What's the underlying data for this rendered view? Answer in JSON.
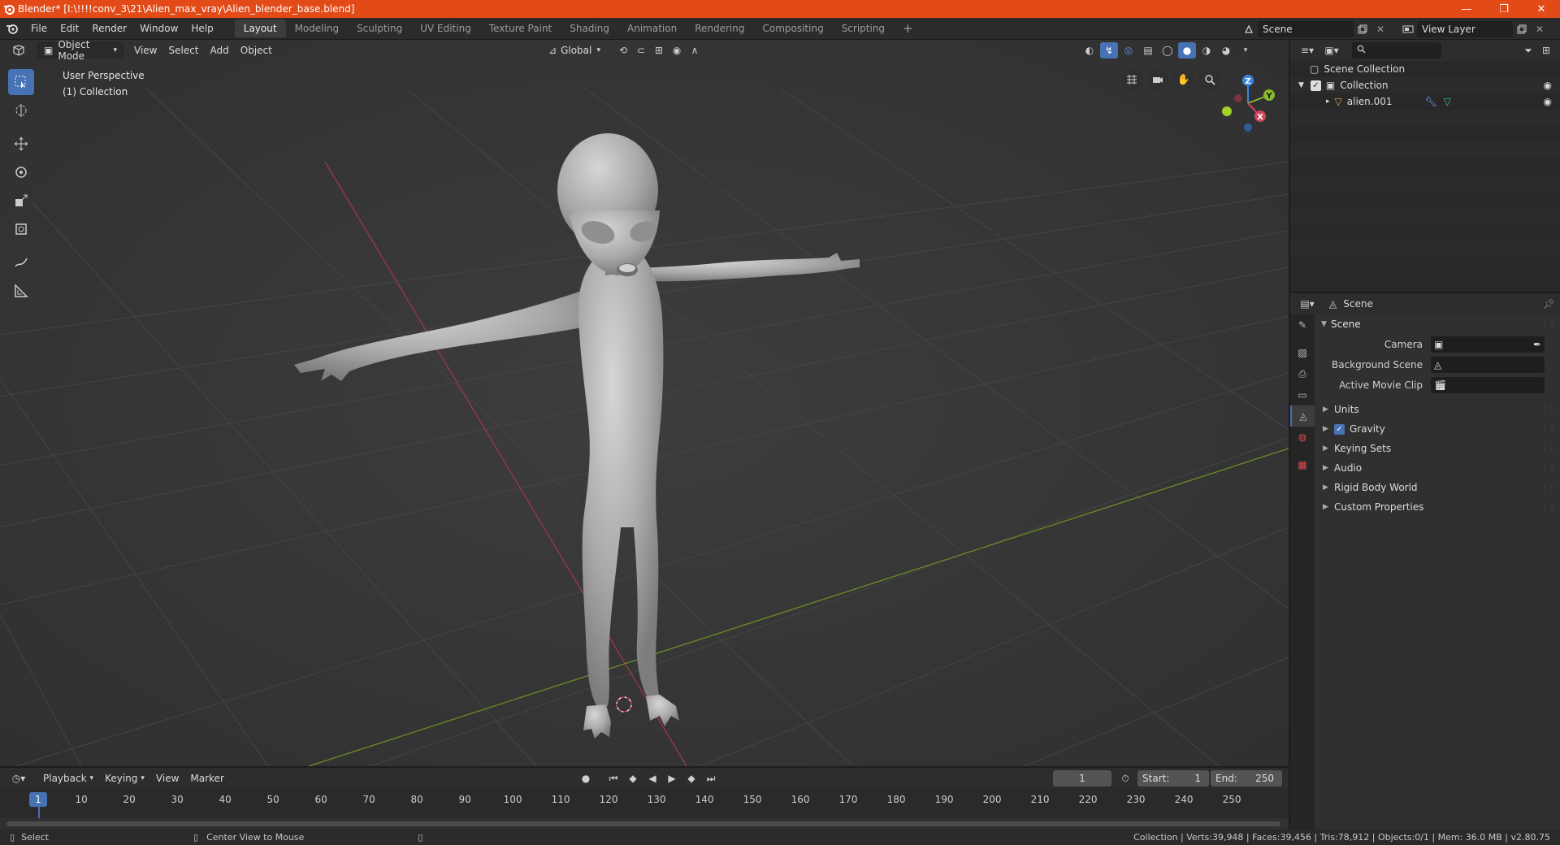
{
  "window": {
    "title": "Blender* [I:\\!!!!conv_3\\21\\Alien_max_vray\\Alien_blender_base.blend]",
    "minimize": "—",
    "maximize": "❐",
    "close": "✕"
  },
  "menu": [
    "File",
    "Edit",
    "Render",
    "Window",
    "Help"
  ],
  "workspaces": [
    "Layout",
    "Modeling",
    "Sculpting",
    "UV Editing",
    "Texture Paint",
    "Shading",
    "Animation",
    "Rendering",
    "Compositing",
    "Scripting"
  ],
  "workspace_add": "+",
  "scene_selector": "Scene",
  "view_layer_selector": "View Layer",
  "viewport": {
    "mode": "Object Mode",
    "menus": [
      "View",
      "Select",
      "Add",
      "Object"
    ],
    "transform_orientation": "Global",
    "perspective_label": "User Perspective",
    "collection_label": "(1) Collection",
    "gizmo_axes": {
      "x": "X",
      "y": "Y",
      "z": "Z"
    }
  },
  "outliner": {
    "root": "Scene Collection",
    "collection": "Collection",
    "object": "alien.001"
  },
  "properties": {
    "header_title": "Scene",
    "panel_title": "Scene",
    "fields": [
      {
        "label": "Camera",
        "value": ""
      },
      {
        "label": "Background Scene",
        "value": ""
      },
      {
        "label": "Active Movie Clip",
        "value": ""
      }
    ],
    "subpanels": [
      "Units",
      "Gravity",
      "Keying Sets",
      "Audio",
      "Rigid Body World",
      "Custom Properties"
    ],
    "gravity_enabled": true
  },
  "timeline": {
    "menus": [
      "Playback",
      "Keying",
      "View",
      "Marker"
    ],
    "current_frame": "1",
    "start_label": "Start:",
    "start_value": "1",
    "end_label": "End:",
    "end_value": "250",
    "ruler_ticks": [
      "10",
      "20",
      "30",
      "40",
      "50",
      "60",
      "70",
      "80",
      "90",
      "100",
      "110",
      "120",
      "130",
      "140",
      "150",
      "160",
      "170",
      "180",
      "190",
      "200",
      "210",
      "220",
      "230",
      "240",
      "250"
    ],
    "cursor_label": "1"
  },
  "statusbar": {
    "select": "Select",
    "center_view": "Center View to Mouse",
    "stats": "Collection | Verts:39,948 | Faces:39,456 | Tris:78,912 | Objects:0/1 | Mem: 36.0 MB | v2.80.75"
  },
  "colors": {
    "titlebar": "#e24a17",
    "accent": "#4772b3",
    "x_axis": "#d1485c",
    "y_axis": "#86b82a",
    "z_axis": "#3a86dd",
    "viewport_bg": "#393939"
  }
}
